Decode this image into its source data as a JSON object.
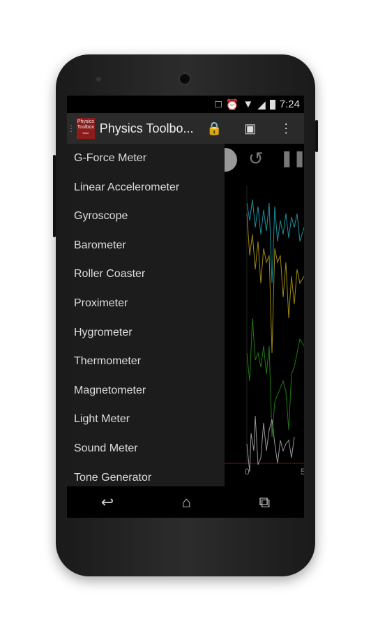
{
  "status": {
    "time": "7:24",
    "icons": [
      "rotate-icon",
      "alarm-icon",
      "wifi-icon",
      "signal-icon",
      "battery-icon"
    ]
  },
  "action_bar": {
    "logo_lines": [
      "Physics",
      "Toolbox",
      "Suite"
    ],
    "title": "Physics Toolbo...",
    "icons": [
      "lock-rotation-icon",
      "lock-screen-icon",
      "overflow-menu-icon"
    ]
  },
  "drawer": {
    "items": [
      "G-Force Meter",
      "Linear Accelerometer",
      "Gyroscope",
      "Barometer",
      "Roller Coaster",
      "Proximeter",
      "Hygrometer",
      "Thermometer",
      "Magnetometer",
      "Light Meter",
      "Sound Meter",
      "Tone Generator"
    ]
  },
  "graph": {
    "x_ticks": [
      "0",
      "5"
    ],
    "colors": {
      "x": "#1a8fa0",
      "y": "#a08a10",
      "z": "#1f7a10",
      "total": "#aaaaaa"
    }
  },
  "nav": {
    "icons": [
      "back-icon",
      "home-icon",
      "recents-icon"
    ]
  }
}
